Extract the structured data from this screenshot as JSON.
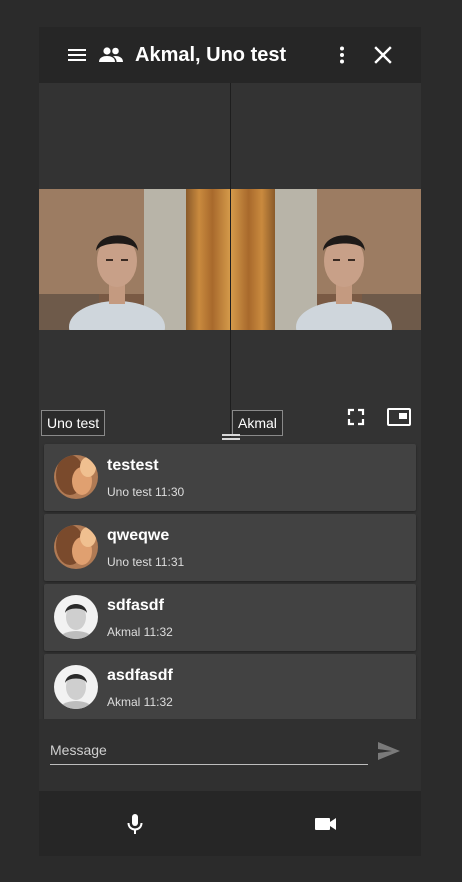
{
  "header": {
    "title": "Akmal, Uno test",
    "icons": [
      "menu-icon",
      "people-icon",
      "more-vert-icon",
      "close-icon"
    ]
  },
  "video": {
    "participants": [
      {
        "name": "Uno test"
      },
      {
        "name": "Akmal"
      }
    ],
    "icons": [
      "fullscreen-icon",
      "picture-in-picture-icon"
    ]
  },
  "messages": [
    {
      "text": "testest",
      "meta": "Uno test 11:30",
      "avatar": "uno"
    },
    {
      "text": "qweqwe",
      "meta": "Uno test 11:31",
      "avatar": "uno"
    },
    {
      "text": "sdfasdf",
      "meta": "Akmal 11:32",
      "avatar": "akmal"
    },
    {
      "text": "asdfasdf",
      "meta": "Akmal 11:32",
      "avatar": "akmal"
    }
  ],
  "composer": {
    "placeholder": "Message",
    "send_icon": "send-icon"
  },
  "bottom_bar": {
    "icons": [
      "microphone-icon",
      "videocam-icon"
    ]
  },
  "colors": {
    "background": "#2b2b2b",
    "panel": "#333333",
    "header": "#262626",
    "message_card": "#424242"
  }
}
